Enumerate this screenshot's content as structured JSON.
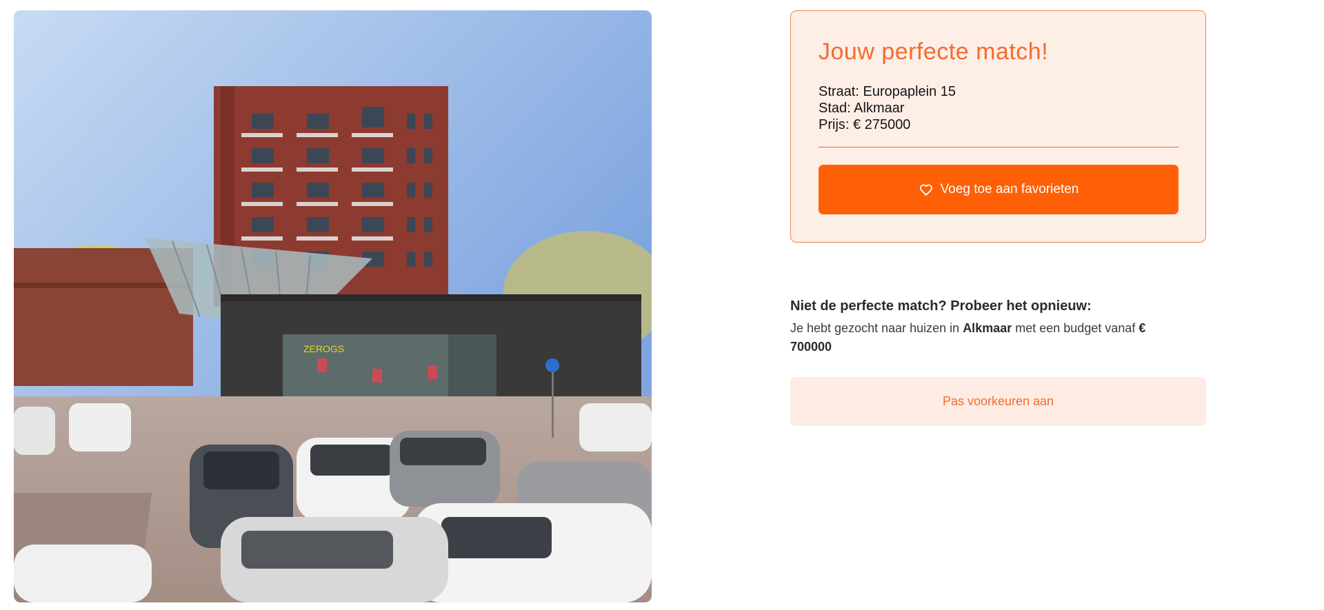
{
  "photo": {
    "alt": "Appartementencomplex aan het Europaplein met winkels en parkeerplaats"
  },
  "match": {
    "title": "Jouw perfecte match!",
    "street_label": "Straat:",
    "street": "Europaplein 15",
    "city_label": "Stad:",
    "city": "Alkmaar",
    "price_label": "Prijs:",
    "price": "€ 275000",
    "favorite_button": "Voeg toe aan favorieten",
    "favorite_icon": "heart-icon"
  },
  "retry": {
    "heading": "Niet de perfecte match? Probeer het opnieuw:",
    "text_prefix": "Je hebt gezocht naar huizen in",
    "city": "Alkmaar",
    "text_middle": "met een budget vanaf",
    "budget": "€ 700000",
    "preferences_button": "Pas voorkeuren aan"
  },
  "colors": {
    "accent": "#ff5f06",
    "accent_text": "#f46b2e",
    "card_background": "#fdeee6",
    "card_border": "#f0864a"
  }
}
